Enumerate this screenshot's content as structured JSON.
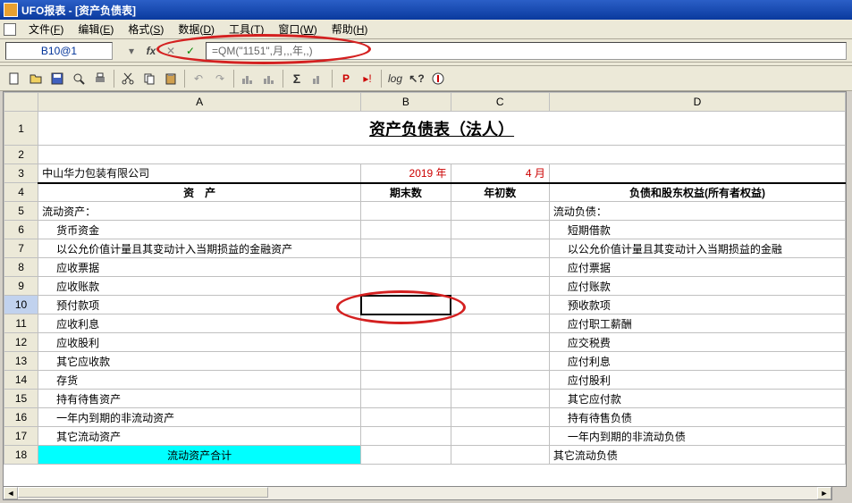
{
  "title": "UFO报表 - [资产负债表]",
  "menus": [
    "文件(F)",
    "编辑(E)",
    "格式(S)",
    "数据(D)",
    "工具(T)",
    "窗口(W)",
    "帮助(H)"
  ],
  "cell_ref": "B10@1",
  "formula": "=QM(\"1151\",月,,,年,,)",
  "cols": [
    "A",
    "B",
    "C",
    "D"
  ],
  "title_text": "资产负债表（法人）",
  "company": "中山华力包装有限公司",
  "year_text": "2019 年",
  "month_text": "4 月",
  "hdr": {
    "a": "资　产",
    "b": "期末数",
    "c": "年初数",
    "d": "负债和股东权益(所有者权益)"
  },
  "rows": [
    {
      "n": "5",
      "a": "流动资产：",
      "d": "流动负债："
    },
    {
      "n": "6",
      "a": "货币资金",
      "d": "短期借款",
      "indent": true
    },
    {
      "n": "7",
      "a": "以公允价值计量且其变动计入当期损益的金融资产",
      "d": "以公允价值计量且其变动计入当期损益的金融",
      "indent": true
    },
    {
      "n": "8",
      "a": "应收票据",
      "d": "应付票据",
      "indent": true
    },
    {
      "n": "9",
      "a": "应收账款",
      "d": "应付账款",
      "indent": true
    },
    {
      "n": "10",
      "a": "预付款项",
      "d": "预收款项",
      "indent": true,
      "selected": true
    },
    {
      "n": "11",
      "a": "应收利息",
      "d": "应付职工薪酬",
      "indent": true
    },
    {
      "n": "12",
      "a": "应收股利",
      "d": "应交税费",
      "indent": true
    },
    {
      "n": "13",
      "a": "其它应收款",
      "d": "应付利息",
      "indent": true
    },
    {
      "n": "14",
      "a": "存货",
      "d": "应付股利",
      "indent": true
    },
    {
      "n": "15",
      "a": "持有待售资产",
      "d": "其它应付款",
      "indent": true
    },
    {
      "n": "16",
      "a": "一年内到期的非流动资产",
      "d": "持有待售负债",
      "indent": true
    },
    {
      "n": "17",
      "a": "其它流动资产",
      "d": "一年内到期的非流动负债",
      "indent": true,
      "cyan": false
    },
    {
      "n": "18",
      "a": "流动资产合计",
      "d": "其它流动负债",
      "cyan_a": true,
      "center_a": true
    }
  ],
  "chart_data": {
    "type": "table",
    "title": "资产负债表（法人）",
    "company": "中山华力包装有限公司",
    "period": "2019 年 4 月",
    "columns": [
      "资产",
      "期末数",
      "年初数",
      "负债和股东权益(所有者权益)"
    ],
    "assets_section": "流动资产：",
    "liabilities_section": "流动负债：",
    "asset_items": [
      "货币资金",
      "以公允价值计量且其变动计入当期损益的金融资产",
      "应收票据",
      "应收账款",
      "预付款项",
      "应收利息",
      "应收股利",
      "其它应收款",
      "存货",
      "持有待售资产",
      "一年内到期的非流动资产",
      "其它流动资产",
      "流动资产合计"
    ],
    "liability_items": [
      "短期借款",
      "以公允价值计量且其变动计入当期损益的金融",
      "应付票据",
      "应付账款",
      "预收款项",
      "应付职工薪酬",
      "应交税费",
      "应付利息",
      "应付股利",
      "其它应付款",
      "持有待售负债",
      "一年内到期的非流动负债",
      "其它流动负债"
    ]
  }
}
